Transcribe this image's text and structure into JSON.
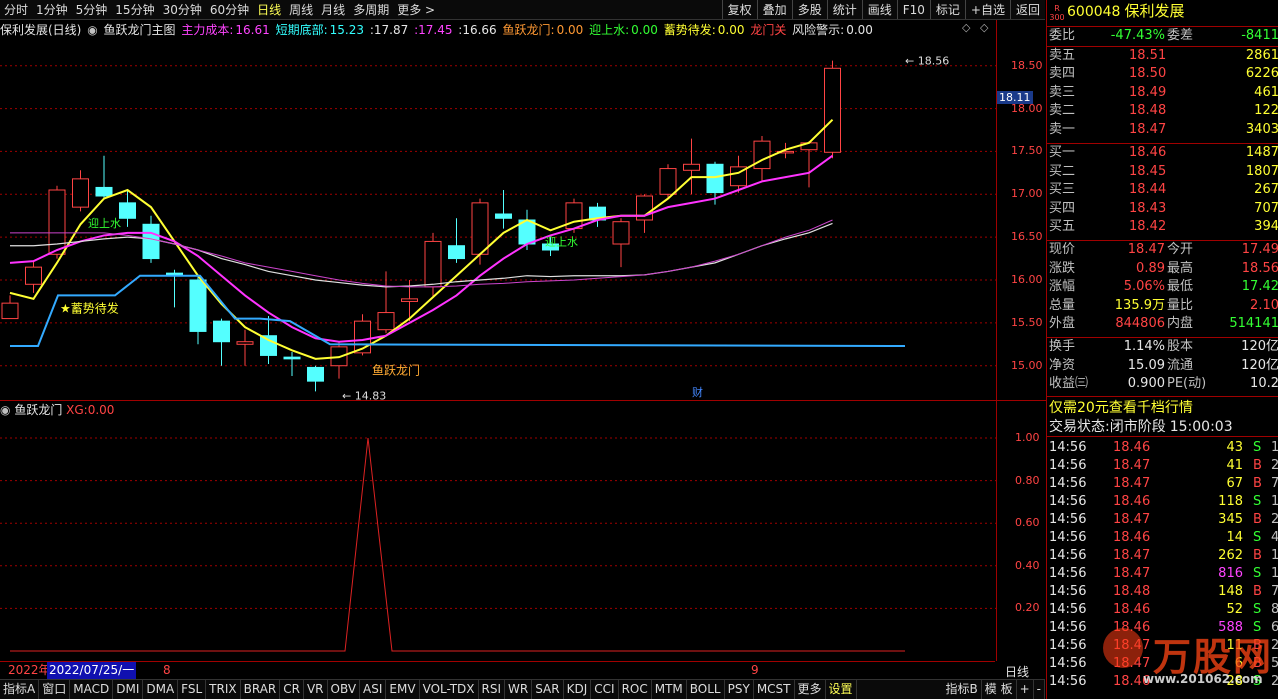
{
  "topbar": {
    "tabs": [
      "分时",
      "1分钟",
      "5分钟",
      "15分钟",
      "30分钟",
      "60分钟",
      "日线",
      "周线",
      "月线",
      "多周期",
      "更多 >"
    ],
    "active": "日线",
    "right": [
      "复权",
      "叠加",
      "多股",
      "统计",
      "画线",
      "F10",
      "标记",
      "+自选",
      "返回"
    ]
  },
  "info": {
    "title": "保利发展(日线)",
    "formula": "鱼跃龙门主图",
    "zlcb_l": "主力成本:",
    "zlcb_v": "16.61",
    "dqdb_l": "短期底部:",
    "dqdb_v": "15.23",
    "v1": ":17.87",
    "v2": ":17.45",
    "v3": ":16.66",
    "yylm_l": "鱼跃龙门:",
    "yylm_v": "0.00",
    "ysz_l": "迎上水:",
    "ysz_v": "0.00",
    "xsdf_l": "蓄势待发:",
    "xsdf_v": "0.00",
    "lmg_l": "龙门关",
    "fxjs_l": "风险警示:",
    "fxjs_v": "0.00"
  },
  "scale": {
    "main": [
      "18.50",
      "18.00",
      "17.50",
      "17.00",
      "16.50",
      "16.00",
      "15.50",
      "15.00"
    ],
    "current": "18.11",
    "sub": [
      "1.00",
      "0.80",
      "0.60",
      "0.40",
      "0.20"
    ]
  },
  "annotations": {
    "high": "18.56",
    "low": "14.83",
    "yingshangshui": "迎上水",
    "xushi": "★蓄势待发",
    "yuyue": "鱼跃龙门",
    "cai": "财"
  },
  "sub": {
    "title": "鱼跃龙门",
    "xg_l": "XG:",
    "xg_v": "0.00"
  },
  "dates": {
    "year": "2022年",
    "cursor": "2022/07/25/一",
    "m8": "8",
    "m9": "9",
    "period": "日线"
  },
  "bottomtabs": [
    "指标A",
    "窗口",
    "MACD",
    "DMI",
    "DMA",
    "FSL",
    "TRIX",
    "BRAR",
    "CR",
    "VR",
    "OBV",
    "ASI",
    "EMV",
    "VOL-TDX",
    "RSI",
    "WR",
    "SAR",
    "KDJ",
    "CCI",
    "ROC",
    "MTM",
    "BOLL",
    "PSY",
    "MCST",
    "更多",
    "设置"
  ],
  "bottomright": [
    "指标B",
    "模 板",
    "+",
    "-"
  ],
  "stock": {
    "code": "600048",
    "name": "保利发展",
    "badge_top": "R",
    "badge_num": "300"
  },
  "weibi": {
    "l": "委比",
    "v": "-47.43%",
    "l2": "委差",
    "v2": "-8411"
  },
  "asks": [
    {
      "l": "卖五",
      "p": "18.51",
      "v": "2861"
    },
    {
      "l": "卖四",
      "p": "18.50",
      "v": "6226"
    },
    {
      "l": "卖三",
      "p": "18.49",
      "v": "461"
    },
    {
      "l": "卖二",
      "p": "18.48",
      "v": "122"
    },
    {
      "l": "卖一",
      "p": "18.47",
      "v": "3403"
    }
  ],
  "bids": [
    {
      "l": "买一",
      "p": "18.46",
      "v": "1487"
    },
    {
      "l": "买二",
      "p": "18.45",
      "v": "1807"
    },
    {
      "l": "买三",
      "p": "18.44",
      "v": "267"
    },
    {
      "l": "买四",
      "p": "18.43",
      "v": "707"
    },
    {
      "l": "买五",
      "p": "18.42",
      "v": "394"
    }
  ],
  "quote": [
    {
      "l": "现价",
      "v": "18.47",
      "l2": "今开",
      "v2": "17.49"
    },
    {
      "l": "涨跌",
      "v": "0.89",
      "l2": "最高",
      "v2": "18.56"
    },
    {
      "l": "涨幅",
      "v": "5.06%",
      "l2": "最低",
      "v2": "17.42"
    },
    {
      "l": "总量",
      "v": "135.9万",
      "l2": "量比",
      "v2": "2.10"
    },
    {
      "l": "外盘",
      "v": "844806",
      "l2": "内盘",
      "v2": "514141"
    }
  ],
  "fin": [
    {
      "l": "换手",
      "v": "1.14%",
      "l2": "股本",
      "v2": "120亿"
    },
    {
      "l": "净资",
      "v": "15.09",
      "l2": "流通",
      "v2": "120亿"
    },
    {
      "l": "收益㈢",
      "v": "0.900",
      "l2": "PE(动)",
      "v2": "10.2"
    }
  ],
  "promo": "仅需20元查看千档行情",
  "status": {
    "l": "交易状态:",
    "v": "闭市阶段",
    "t": "15:00:03"
  },
  "ticks": [
    {
      "t": "14:56",
      "p": "18.46",
      "v": "43",
      "s": "S",
      "n": "1"
    },
    {
      "t": "14:56",
      "p": "18.47",
      "v": "41",
      "s": "B",
      "n": "2"
    },
    {
      "t": "14:56",
      "p": "18.47",
      "v": "67",
      "s": "B",
      "n": "7"
    },
    {
      "t": "14:56",
      "p": "18.46",
      "v": "118",
      "s": "S",
      "n": "15"
    },
    {
      "t": "14:56",
      "p": "18.47",
      "v": "345",
      "s": "B",
      "n": "2"
    },
    {
      "t": "14:56",
      "p": "18.46",
      "v": "14",
      "s": "S",
      "n": "4"
    },
    {
      "t": "14:56",
      "p": "18.47",
      "v": "262",
      "s": "B",
      "n": "14"
    },
    {
      "t": "14:56",
      "p": "18.47",
      "v": "816",
      "s": "S",
      "n": "14"
    },
    {
      "t": "14:56",
      "p": "18.48",
      "v": "148",
      "s": "B",
      "n": "7"
    },
    {
      "t": "14:56",
      "p": "18.46",
      "v": "52",
      "s": "S",
      "n": "8"
    },
    {
      "t": "14:56",
      "p": "18.46",
      "v": "588",
      "s": "S",
      "n": "65"
    },
    {
      "t": "14:56",
      "p": "18.47",
      "v": "11",
      "s": "B",
      "n": "26"
    },
    {
      "t": "14:56",
      "p": "18.47",
      "v": "6",
      "s": "B",
      "n": "5"
    },
    {
      "t": "14:56",
      "p": "18.46",
      "v": "28",
      "s": "S",
      "n": "28"
    }
  ],
  "watermark": {
    "brand": "万股网",
    "url": "www.201062.com"
  },
  "colors": {
    "up": "#ff4444",
    "down": "#54ffff",
    "ma_yellow": "#ffff33",
    "ma_magenta": "#ff33ff",
    "ma_white": "#e0e0e0",
    "blue_line": "#33aaff",
    "grid": "#a00000"
  }
}
